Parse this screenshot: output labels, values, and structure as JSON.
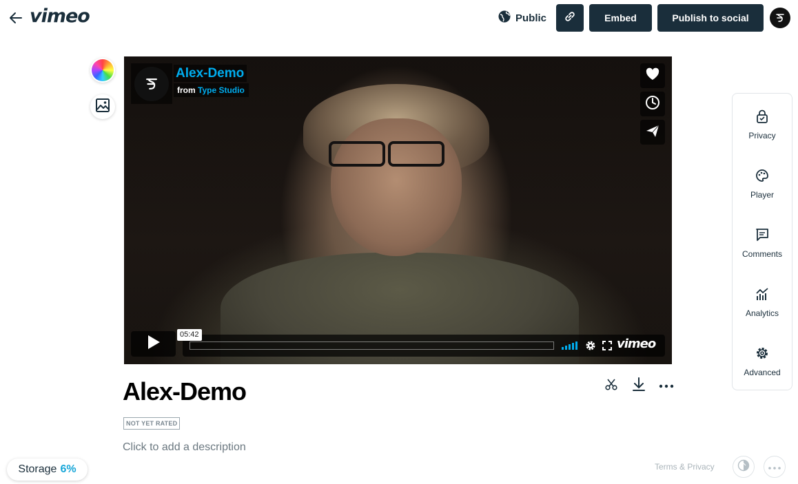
{
  "header": {
    "logo": "vimeo",
    "privacy_label": "Public",
    "embed_label": "Embed",
    "publish_label": "Publish to social"
  },
  "player": {
    "title": "Alex-Demo",
    "from_prefix": "from",
    "owner": "Type Studio",
    "time_tooltip": "05:42",
    "brand": "vimeo"
  },
  "video": {
    "title": "Alex-Demo",
    "rating": "NOT YET RATED",
    "description_placeholder": "Click to add a description"
  },
  "right_panel": {
    "items": [
      {
        "label": "Privacy",
        "icon": "lock-icon"
      },
      {
        "label": "Player",
        "icon": "palette-icon"
      },
      {
        "label": "Comments",
        "icon": "comment-icon"
      },
      {
        "label": "Analytics",
        "icon": "analytics-icon"
      },
      {
        "label": "Advanced",
        "icon": "gear-icon"
      }
    ]
  },
  "footer": {
    "storage_label": "Storage",
    "storage_percent": "6%",
    "terms_label": "Terms & Privacy"
  },
  "colors": {
    "primary_dark": "#1a2e3b",
    "accent_blue": "#00adef",
    "storage_blue": "#17a6d8"
  }
}
